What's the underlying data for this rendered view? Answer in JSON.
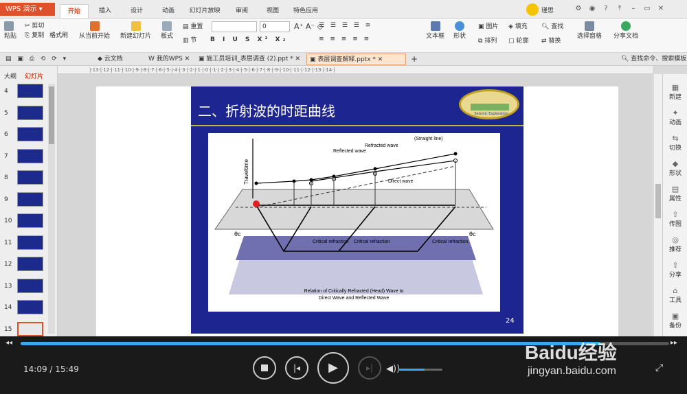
{
  "app": {
    "name": "WPS 演示"
  },
  "menu_tabs": [
    "开始",
    "插入",
    "设计",
    "动画",
    "幻灯片放映",
    "审阅",
    "视图",
    "特色应用"
  ],
  "user": {
    "name": "瑾思"
  },
  "ribbon": {
    "paste": "粘贴",
    "cut": "剪切",
    "copy": "复制",
    "format_painter": "格式刷",
    "from_current": "从当前开始",
    "new_slide": "新建幻灯片",
    "layout": "板式",
    "reset": "重置",
    "section": "节",
    "font_size": "0",
    "text_box": "文本框",
    "shape": "形状",
    "picture": "图片",
    "fill": "填充",
    "arrange": "排列",
    "outline": "轮廓",
    "find": "查找",
    "replace": "替换",
    "select_pane": "选择窗格",
    "share_doc": "分享文档"
  },
  "doc_tabs": [
    {
      "label": "云文档"
    },
    {
      "label": "我的WPS"
    },
    {
      "label": "施工员培训_表层调查 (2).ppt *"
    },
    {
      "label": "表层调查解释.pptx *"
    }
  ],
  "search_cmd": "查找命令、搜索模板",
  "left_panel": {
    "tab_outline": "大纲",
    "tab_slides": "幻灯片",
    "slide_numbers": [
      "4",
      "5",
      "6",
      "7",
      "8",
      "9",
      "10",
      "11",
      "12",
      "13",
      "14",
      "15"
    ]
  },
  "slide": {
    "title": "二、折射波的时距曲线",
    "page_number": "24",
    "logo_text": "Seismic Exploration",
    "figure": {
      "ylabel": "Traveltime",
      "labels": [
        "Reflected wave",
        "Refracted wave",
        "(Straight line)",
        "Direct wave",
        "Critical refraction",
        "Critical refraction",
        "Critical refraction",
        "θc",
        "θc"
      ],
      "caption_line1": "Relation of Critically Refracted (Head) Wave to",
      "caption_line2": "Direct Wave and Reflected Wave"
    }
  },
  "right_panel": [
    "新建",
    "动画",
    "切换",
    "形状",
    "属性",
    "传图",
    "推荐",
    "分享",
    "工具",
    "备份"
  ],
  "player": {
    "time": "14:09 / 15:49",
    "progress": 0.894,
    "volume": 0.6
  },
  "watermark": {
    "brand": "Baidu经验",
    "url": "jingyan.baidu.com"
  },
  "colors": {
    "accent": "#e0502a",
    "slide_bg": "#1d2590",
    "progress": "#3aa8ea"
  }
}
